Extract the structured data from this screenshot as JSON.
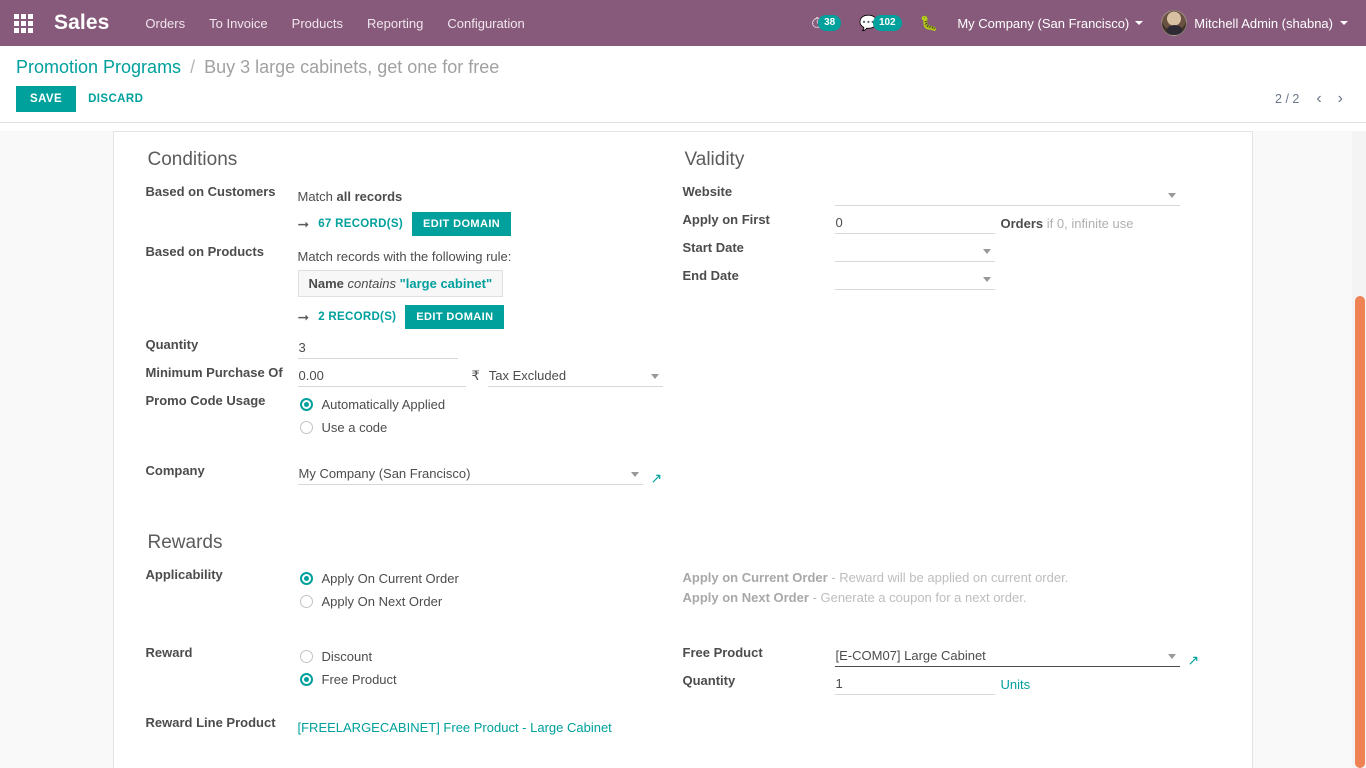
{
  "navbar": {
    "apps_icon": "apps-grid-icon",
    "brand": "Sales",
    "menu": [
      "Orders",
      "To Invoice",
      "Products",
      "Reporting",
      "Configuration"
    ],
    "systray": {
      "activity_icon": "clock-activity-icon",
      "activity_count": "38",
      "messages_icon": "chat-bubble-icon",
      "messages_count": "102",
      "debug_icon": "bug-icon",
      "company": "My Company (San Francisco)",
      "user": "Mitchell Admin (shabna)",
      "avatar": "user-avatar"
    },
    "accent_purple": "#875A7B",
    "accent_teal": "#00A09D"
  },
  "control_panel": {
    "breadcrumb_root": "Promotion Programs",
    "breadcrumb_sep": "/",
    "breadcrumb_current": "Buy 3 large cabinets, get one for free",
    "save_label": "SAVE",
    "discard_label": "DISCARD",
    "pager_value": "2 / 2",
    "pager_prev_icon": "chevron-left-icon",
    "pager_next_icon": "chevron-right-icon"
  },
  "conditions": {
    "title": "Conditions",
    "based_on_customers": {
      "label": "Based on Customers",
      "match_prefix": "Match",
      "match_strong": "all records",
      "arrow_icon": "arrow-right-icon",
      "records_link": "67 RECORD(S)",
      "edit_domain": "EDIT DOMAIN"
    },
    "based_on_products": {
      "label": "Based on Products",
      "match_text": "Match records with the following rule:",
      "rule_field": "Name",
      "rule_operator": "contains",
      "rule_value": "\"large cabinet\"",
      "arrow_icon": "arrow-right-icon",
      "records_link": "2 RECORD(S)",
      "edit_domain": "EDIT DOMAIN"
    },
    "quantity": {
      "label": "Quantity",
      "value": "3"
    },
    "minimum_purchase": {
      "label": "Minimum Purchase Of",
      "value": "0.00",
      "currency": "₹",
      "tax_option": "Tax Excluded"
    },
    "promo_code_usage": {
      "label": "Promo Code Usage",
      "options": [
        "Automatically Applied",
        "Use a code"
      ],
      "selected": "Automatically Applied"
    },
    "company": {
      "label": "Company",
      "value": "My Company (San Francisco)",
      "external_link_icon": "external-link-icon"
    }
  },
  "validity": {
    "title": "Validity",
    "website": {
      "label": "Website",
      "value": ""
    },
    "apply_on_first": {
      "label": "Apply on First",
      "value": "0",
      "suffix_strong": "Orders",
      "suffix_muted": "if 0, infinite use"
    },
    "start_date": {
      "label": "Start Date",
      "value": ""
    },
    "end_date": {
      "label": "End Date",
      "value": ""
    }
  },
  "rewards": {
    "title": "Rewards",
    "applicability": {
      "label": "Applicability",
      "options": [
        "Apply On Current Order",
        "Apply On Next Order"
      ],
      "selected": "Apply On Current Order"
    },
    "help": [
      {
        "strong": "Apply on Current Order",
        "text": " - Reward will be applied on current order."
      },
      {
        "strong": "Apply on Next Order",
        "text": " - Generate a coupon for a next order."
      }
    ],
    "reward": {
      "label": "Reward",
      "options": [
        "Discount",
        "Free Product"
      ],
      "selected": "Free Product"
    },
    "reward_line_product": {
      "label": "Reward Line Product",
      "value": "[FREELARGECABINET] Free Product - Large Cabinet"
    },
    "free_product": {
      "label": "Free Product",
      "value": "[E-COM07] Large Cabinet",
      "external_link_icon": "external-link-icon"
    },
    "free_product_quantity": {
      "label": "Quantity",
      "value": "1",
      "uom": "Units"
    }
  },
  "scrollbar": {
    "thumb_color": "#ef8354"
  }
}
